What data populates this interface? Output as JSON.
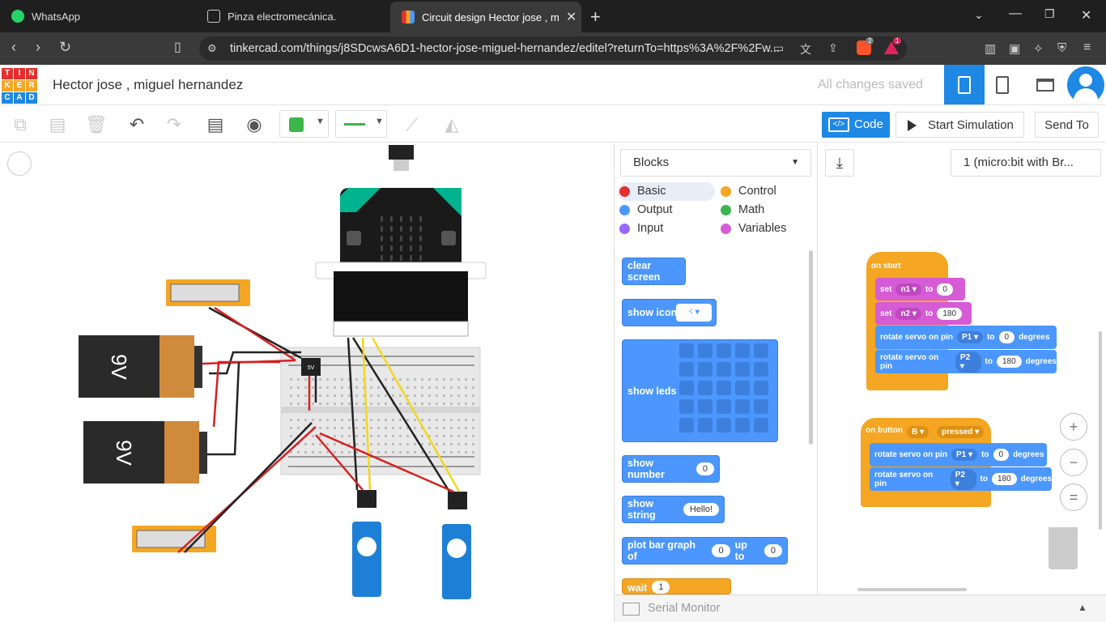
{
  "browser": {
    "tabs": [
      {
        "title": "WhatsApp"
      },
      {
        "title": "Pinza electromecánica."
      },
      {
        "title": "Circuit design Hector jose , mig"
      }
    ],
    "url": "tinkercad.com/things/j8SDcwsA6D1-hector-jose-miguel-hernandez/editel?returnTo=https%3A%2F%2Fw...",
    "brave_badge": "2",
    "alert_badge": "1"
  },
  "app": {
    "logo_letters": [
      "T",
      "I",
      "N",
      "K",
      "E",
      "R",
      "C",
      "A",
      "D"
    ],
    "project_title": "Hector jose , miguel hernandez",
    "save_status": "All changes saved"
  },
  "toolbar": {
    "code_label": "Code",
    "sim_label": "Start Simulation",
    "send_label": "Send To",
    "fill_color": "#3cb54a",
    "wire_color": "#3cb54a"
  },
  "code_panel": {
    "mode": "Blocks",
    "device": "1 (micro:bit with Br...",
    "categories": [
      {
        "label": "Basic",
        "color": "#e62e2e"
      },
      {
        "label": "Control",
        "color": "#f5a623"
      },
      {
        "label": "Output",
        "color": "#4c97ff"
      },
      {
        "label": "Math",
        "color": "#3cb54a"
      },
      {
        "label": "Input",
        "color": "#9966ff"
      },
      {
        "label": "Variables",
        "color": "#d65cd6"
      }
    ],
    "palette": {
      "clear_screen": "clear screen",
      "show_icon": "show icon",
      "show_leds": "show leds",
      "show_number": "show number",
      "show_number_val": "0",
      "show_string": "show string",
      "show_string_val": "Hello!",
      "plot_bar": "plot bar graph of",
      "up_to": "up to",
      "plot_val1": "0",
      "plot_val2": "0",
      "wait": "wait",
      "wait_val": "1"
    },
    "workspace": {
      "on_start": "on start",
      "set": "set",
      "to": "to",
      "n1": "n1",
      "n1_val": "0",
      "n2": "n2",
      "n2_val": "180",
      "rotate": "rotate servo on pin",
      "degrees": "degrees",
      "p1": "P1",
      "p2": "P2",
      "start_p1_val": "0",
      "start_p2_val": "180",
      "on_button": "on button",
      "button": "B",
      "pressed": "pressed",
      "btn_p1_val": "0",
      "btn_p2_val": "180"
    },
    "serial_monitor": "Serial Monitor"
  },
  "circuit": {
    "battery_label": "9V",
    "reg_label": "5V"
  }
}
